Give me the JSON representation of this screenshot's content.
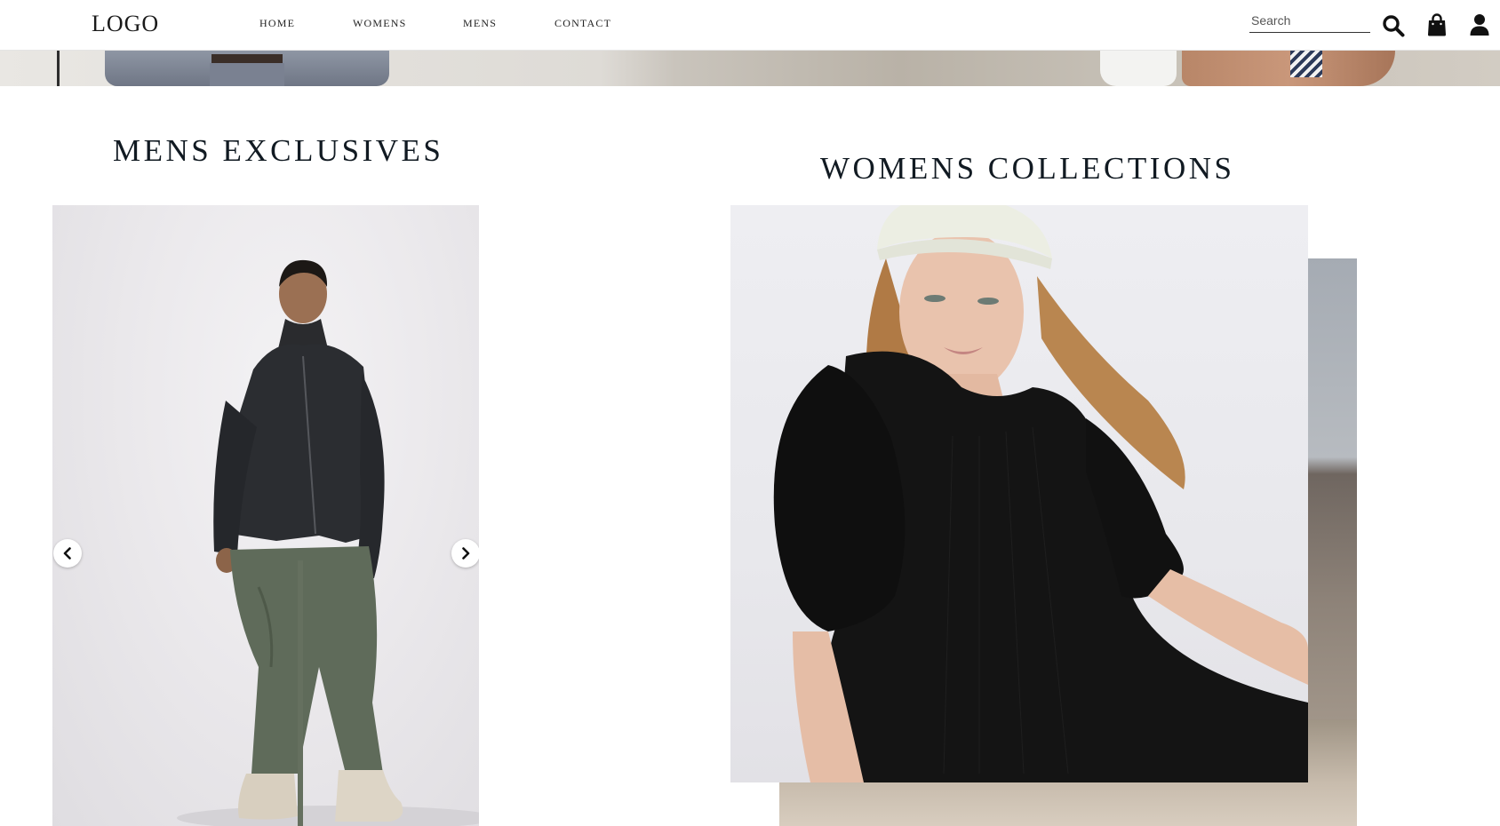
{
  "header": {
    "logo": "LOGO",
    "nav": [
      {
        "label": "HOME"
      },
      {
        "label": "WOMENS"
      },
      {
        "label": "MENS"
      },
      {
        "label": "CONTACT"
      }
    ],
    "search": {
      "placeholder": "Search",
      "value": ""
    },
    "icons": [
      "search-icon",
      "shopping-bag-icon",
      "user-icon"
    ]
  },
  "sections": {
    "mens": {
      "title": "MENS EXCLUSIVES",
      "carousel": {
        "prev_icon": "chevron-left-icon",
        "next_icon": "chevron-right-icon"
      }
    },
    "womens": {
      "title": "WOMENS COLLECTIONS"
    }
  },
  "colors": {
    "text": "#111a22",
    "background": "#ffffff",
    "icon": "#111111"
  }
}
